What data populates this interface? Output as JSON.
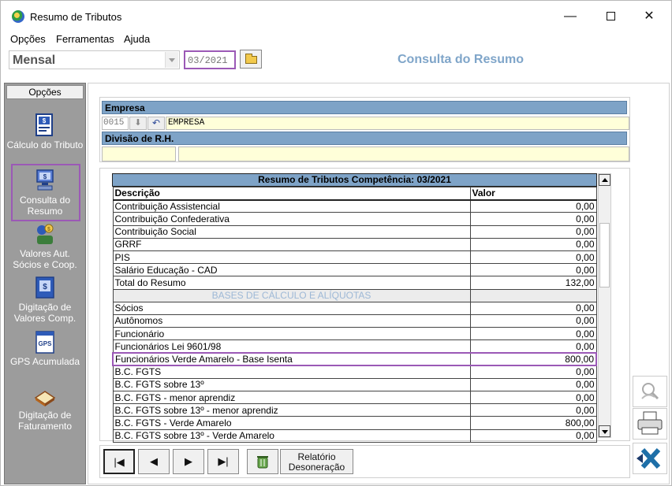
{
  "window": {
    "title": "Resumo de Tributos",
    "minimize": "—",
    "close": "✕"
  },
  "menu": [
    "Opções",
    "Ferramentas",
    "Ajuda"
  ],
  "toolbar": {
    "period_value": "Mensal",
    "competencia": "03/2021",
    "screen_title": "Consulta do Resumo"
  },
  "sidebar": {
    "header": "Opções",
    "items": [
      {
        "label": "Cálculo do Tributo",
        "icon": "calculator-document-icon"
      },
      {
        "label": "Consulta do Resumo",
        "icon": "consult-computer-icon",
        "selected": true
      },
      {
        "label": "Valores Aut. Sócios e  Coop.",
        "icon": "partners-values-icon"
      },
      {
        "label": "Digitação de Valores Comp.",
        "icon": "entry-values-icon"
      },
      {
        "label": "GPS Acumulada",
        "icon": "gps-document-icon"
      },
      {
        "label": "Digitação de Faturamento",
        "icon": "billing-book-icon"
      }
    ]
  },
  "empresa": {
    "section_label": "Empresa",
    "code": "0015",
    "name": "EMPRESA",
    "divisao_label": "Divisão de R.H.",
    "divisao_code": "",
    "divisao_name": ""
  },
  "grid": {
    "title": "Resumo de Tributos Competência: 03/2021",
    "columns": [
      "Descrição",
      "Valor"
    ],
    "rows": [
      {
        "desc": "Contribuição Assistencial",
        "value": "0,00"
      },
      {
        "desc": "Contribuição Confederativa",
        "value": "0,00"
      },
      {
        "desc": "Contribuição Social",
        "value": "0,00"
      },
      {
        "desc": "GRRF",
        "value": "0,00"
      },
      {
        "desc": "PIS",
        "value": "0,00"
      },
      {
        "desc": "Salário Educação - CAD",
        "value": "0,00"
      },
      {
        "desc": "Total do Resumo",
        "value": "132,00"
      },
      {
        "desc": "BASES DE CÁLCULO E ALÍQUOTAS",
        "value": "",
        "section": true
      },
      {
        "desc": "Sócios",
        "value": "0,00"
      },
      {
        "desc": "Autônomos",
        "value": "0,00"
      },
      {
        "desc": "Funcionário",
        "value": "0,00"
      },
      {
        "desc": "Funcionários Lei 9601/98",
        "value": "0,00"
      },
      {
        "desc": "Funcionários Verde Amarelo - Base Isenta",
        "value": "800,00",
        "highlight": true
      },
      {
        "desc": "B.C. FGTS",
        "value": "0,00"
      },
      {
        "desc": "B.C. FGTS sobre 13º",
        "value": "0,00"
      },
      {
        "desc": "B.C. FGTS - menor aprendiz",
        "value": "0,00"
      },
      {
        "desc": "B.C. FGTS sobre 13º - menor aprendiz",
        "value": "0,00"
      },
      {
        "desc": "B.C. FGTS - Verde Amarelo",
        "value": "800,00"
      },
      {
        "desc": "B.C. FGTS sobre 13º - Verde Amarelo",
        "value": "0,00"
      }
    ]
  },
  "navigation": {
    "first": "|◀",
    "prev": "◀",
    "next": "▶",
    "last": "▶|",
    "report_label": "Relatório Desoneração"
  },
  "colors": {
    "section_blue": "#7ea3c7",
    "highlight_purple": "#9b59b6",
    "input_yellow": "#ffffd9",
    "sidebar_gray": "#9c9c9c"
  }
}
